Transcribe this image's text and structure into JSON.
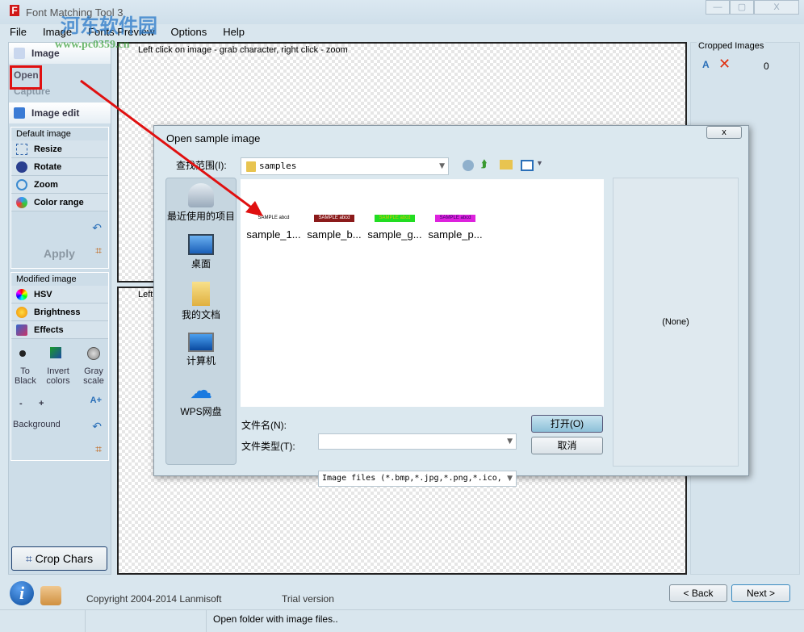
{
  "window": {
    "title": "Font Matching Tool 3",
    "controls": [
      "—",
      "▢",
      "X"
    ]
  },
  "watermark": {
    "text": "河东软件园",
    "url": "www.pc0359.cn"
  },
  "menu": [
    "File",
    "Image",
    "Fonts Preview",
    "Options",
    "Help"
  ],
  "left": {
    "image_section": "Image",
    "open": "Open",
    "capture": "Capture",
    "image_edit": "Image edit",
    "default_image": "Default image",
    "default_tools": [
      "Resize",
      "Rotate",
      "Zoom",
      "Color range"
    ],
    "apply": "Apply",
    "modified_image": "Modified image",
    "modified_tools": [
      "HSV",
      "Brightness",
      "Effects"
    ],
    "to_black": "To Black",
    "invert": "Invert colors",
    "gray": "Gray scale",
    "minus": "-",
    "plus": "+",
    "background": "Background",
    "crop_chars": "Crop Chars"
  },
  "canvas": {
    "hint_top": "Left click on image - grab character, right click - zoom",
    "hint_bottom": "Left"
  },
  "right": {
    "title": "Cropped Images",
    "count": "0"
  },
  "dialog": {
    "title": "Open sample image",
    "close": "x",
    "look_in_label": "查找范围(I):",
    "look_in_value": "samples",
    "places": [
      "最近使用的项目",
      "桌面",
      "我的文档",
      "计算机",
      "WPS网盘"
    ],
    "files": [
      {
        "name": "sample_1...",
        "thumb": "SAMPLE abcd",
        "bg": "#ffffff",
        "fg": "#000000"
      },
      {
        "name": "sample_b...",
        "thumb": "SAMPLE abcd",
        "bg": "#8b1a1a",
        "fg": "#ffffff"
      },
      {
        "name": "sample_g...",
        "thumb": "SAMPLE abcd",
        "bg": "#22dd22",
        "fg": "#cccc00"
      },
      {
        "name": "sample_p...",
        "thumb": "SAMPLE abcd",
        "bg": "#dd22dd",
        "fg": "#330066"
      }
    ],
    "preview": "(None)",
    "filename_label": "文件名(N):",
    "filename_value": "",
    "filetype_label": "文件类型(T):",
    "filetype_value": "Image files (*.bmp,*.jpg,*.png,*.ico,",
    "open_btn": "打开(O)",
    "cancel_btn": "取消"
  },
  "footer": {
    "copyright": "Copyright 2004-2014 Lanmisoft",
    "trial": "Trial version",
    "back": "< Back",
    "next": "Next >"
  },
  "status": {
    "text": "Open folder with image files.."
  },
  "colors": {
    "annotation": "#e01010",
    "accent": "#2a6fb8"
  }
}
